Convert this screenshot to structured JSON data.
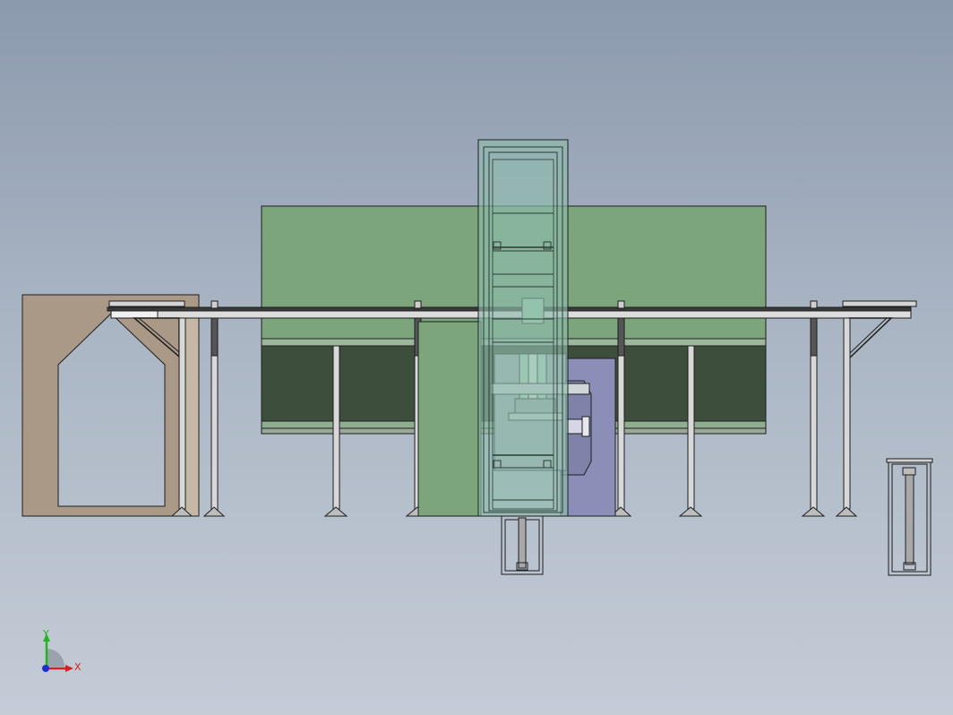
{
  "viewport": {
    "background_top": "#8c9aae",
    "background_bottom": "#c4ccd6"
  },
  "triad": {
    "x_label": "X",
    "y_label": "Y",
    "x_color": "#d62020",
    "y_color": "#22b522",
    "z_color": "#2030d0"
  },
  "colors": {
    "green_panel": "#7ca57c",
    "dark_panel": "#3d4e3d",
    "concrete": "#ab9987",
    "glass": "#8fbcae",
    "lilac": "#8b8fb8",
    "steel": "#7a7a7a",
    "edge": "#1e1e1e"
  }
}
